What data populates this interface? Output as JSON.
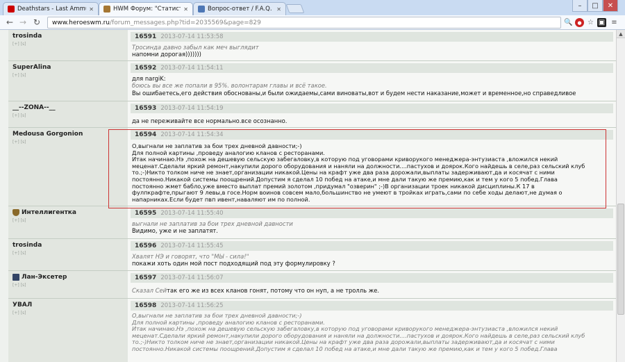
{
  "browser": {
    "tabs": [
      {
        "title": "Deathstars - Last Ammunition",
        "favicon_color": "#cc0000"
      },
      {
        "title": "HWM Форум: \"Статистика с",
        "favicon_color": "#a57733"
      },
      {
        "title": "Вопрос-ответ / F.A.Q.",
        "favicon_color": "#4d77b5"
      }
    ],
    "url_host": "www.heroeswm.ru",
    "url_path": "/forum_messages.php?tid=2035569&page=829",
    "window_controls": [
      "–",
      "□",
      "✕"
    ]
  },
  "posts": [
    {
      "author": "trosinda",
      "sub": "[+] [s]",
      "num": "16591",
      "date": "2013-07-14 11:53:58",
      "quote": "Тросинда давно забыл как меч выглядит",
      "text": "напомни дорогая)))))))"
    },
    {
      "author": "SuperAlina",
      "sub": "[+] [s]",
      "num": "16592",
      "date": "2013-07-14 11:54:11",
      "pre": "для nargiK:",
      "quote": "боюсь вы все же попали в 95%. волонтарам главы и всё такое.",
      "text": "Вы ошибаетесь,его действия обоснованы,и были ожидаемы,сами виноваты,вот и будем нести наказание,может и временное,но справедливое"
    },
    {
      "author": "__--ZONA--__",
      "sub": "[+] [s]",
      "num": "16593",
      "date": "2013-07-14 11:54:19",
      "text": "да не переживайте все нормально.все осознанно."
    },
    {
      "author": "Medousa Gorgonion",
      "sub": "[+] [s]",
      "num": "16594",
      "date": "2013-07-14 11:54:34",
      "text": "О,выгнали не заплатив за бои трех дневной давности;-)\nДля полной картины ,проведу аналогию кланов с ресторанами.\nИтак начинаю.Нэ ,похож на дешевую сельскую забегаловку,в которую под уговорами криворукого менеджера-энтузиаста ,вложился некий\nмеценат.Сделали яркий ремонт,накупили дорого оборудования и наняли на должности....пастухов и доярок.Кого найдешь в селе,раз сельский клуб\nто.;-)Никто толком ниче не знает,организации никакой.Цены на крафт уже два раза дорожали,выплаты задерживают,да и косячат с ними\nпостоянно.Никакой системы поощрений.Допустим я сделал 10 побед на атаке,и мне дали такую же премию,как и тем у кого 5 побед.Глава\nпостоянно жмет бабло,уже вместо выплат премий золотом ,придумал \"озверин\" ;-)В организации троек никакой дисциплины.К 17 в\nфулпкрафте,прыгают 9 левы,в госе.Норм воинов совсем мало,большинство не умеют в тройках играть,сами по себе ходы делают,не думая о\nнапарниках.Если будет пвп ивент,наваляют им по полной."
    },
    {
      "author": "Интеллигентка",
      "sub": "[+] [s]",
      "num": "16595",
      "date": "2013-07-14 11:55:40",
      "clan": "#8a6a2a",
      "quote": "выгнали не заплатив за бои трех дневной давности",
      "text": "Видимо, уже и не заплатят."
    },
    {
      "author": "trosinda",
      "sub": "[+] [s]",
      "num": "16596",
      "date": "2013-07-14 11:55:45",
      "quote": "Хвалят НЭ и говорят, что \"МЫ - сила!\"",
      "text": "покажи хоть один мой пост подходящий под эту формулировку ?"
    },
    {
      "author": "Лан-Эксетер",
      "sub": "[+] [s]",
      "num": "16597",
      "date": "2013-07-14 11:56:07",
      "clan": "#334466",
      "quote": "Сказал Сей",
      "text": "так его же из всех кланов гонят, потому что он нуп, а не тролль же."
    },
    {
      "author": "УВАЛ",
      "sub": "[+] [s]",
      "num": "16598",
      "date": "2013-07-14 11:56:25",
      "quote": "О,выгнали не заплатив за бои трех дневной давности;-)\nДля полной картины ,проведу аналогию кланов с ресторанами.\nИтак начинаю.Нэ ,похож на дешевую сельскую забегаловку,в которую под уговорами криворукого менеджера-энтузиаста ,вложился некий\nмеценат.Сделали яркий ремонт,накупили дорого оборудования и наняли на должности....пастухов и доярок.Кого найдешь в селе,раз сельский клуб\nто.;-)Никто толком ниче не знает,организации никакой.Цены на крафт уже два раза дорожали,выплаты задерживают,да и косячат с ними\nпостоянно.Никакой системы поощрений.Допустим я сделал 10 побед на атаке,и мне дали такую же премию,как и тем у кого 5 побед.Глава"
    }
  ]
}
